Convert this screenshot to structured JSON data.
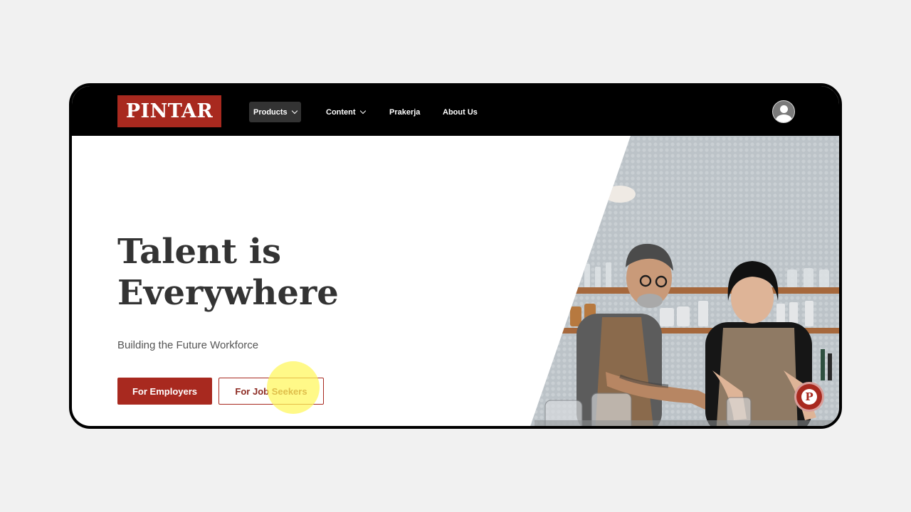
{
  "brand": {
    "logo_text": "PINTAR",
    "color": "#a8291f"
  },
  "nav": {
    "items": [
      {
        "label": "Products",
        "has_dropdown": true,
        "active": true
      },
      {
        "label": "Content",
        "has_dropdown": true,
        "active": false
      },
      {
        "label": "Prakerja",
        "has_dropdown": false,
        "active": false
      },
      {
        "label": "About Us",
        "has_dropdown": false,
        "active": false
      }
    ],
    "avatar_icon": "user-avatar-icon"
  },
  "hero": {
    "title_line1": "Talent is",
    "title_line2": "Everywhere",
    "subtitle": "Building the Future Workforce",
    "primary_button": "For Employers",
    "secondary_button": "For Job Seekers",
    "image": "baristas-in-cafe-photo"
  },
  "chat_widget": {
    "icon": "chat-p-icon",
    "letter": "P"
  },
  "colors": {
    "accent": "#a8291f",
    "nav_bg": "#000000",
    "text_dark": "#333333"
  }
}
